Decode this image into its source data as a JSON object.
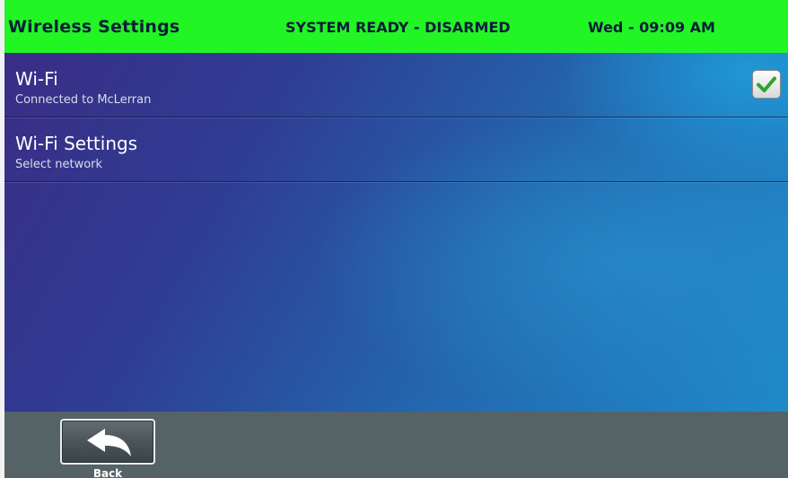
{
  "header": {
    "title": "Wireless Settings",
    "status": "SYSTEM READY - DISARMED",
    "clock": "Wed - 09:09 AM",
    "background_color": "#22f524"
  },
  "list": {
    "items": [
      {
        "label": "Wi-Fi",
        "sublabel": "Connected to McLerran",
        "checked": true
      },
      {
        "label": "Wi-Fi Settings",
        "sublabel": "Select network"
      }
    ]
  },
  "footer": {
    "back_label": "Back",
    "back_icon": "back-arrow-icon"
  },
  "colors": {
    "checkmark": "#2aa52a",
    "footer": "#556367"
  }
}
